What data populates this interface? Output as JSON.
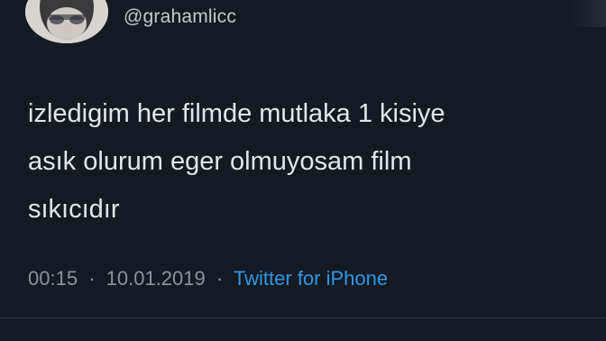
{
  "tweet": {
    "handle": "@grahamlicc",
    "text_lines": [
      "izledigim her filmde mutlaka 1 kisiye",
      "asık olurum eger olmuyosam film",
      "sıkıcıdır"
    ],
    "time": "00:15",
    "separator": "·",
    "date": "10.01.2019",
    "source": "Twitter for iPhone"
  },
  "colors": {
    "background": "#131a22",
    "text": "#e3e6ea",
    "meta": "#8a939c",
    "link": "#2f95e6"
  },
  "icons": {
    "avatar": "profile-avatar"
  }
}
